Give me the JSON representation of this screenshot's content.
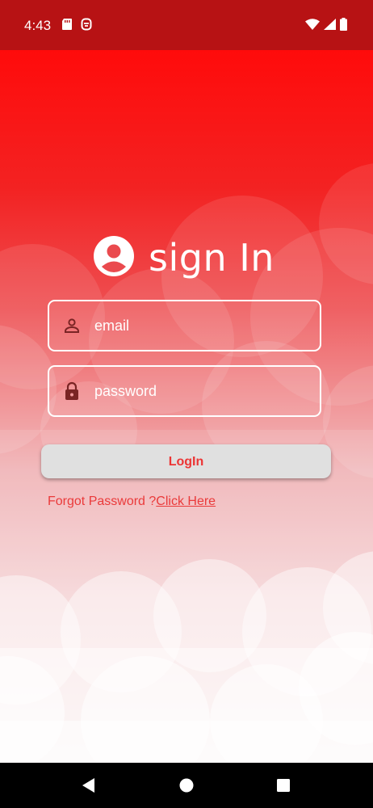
{
  "status_bar": {
    "time": "4:43",
    "left_icons": [
      "sd-card-icon",
      "notification-icon"
    ],
    "right_icons": [
      "wifi-icon",
      "cellular-signal-icon",
      "battery-icon"
    ]
  },
  "login": {
    "title": "sign In",
    "title_icon": "account-circle-icon",
    "email": {
      "placeholder": "email",
      "value": "",
      "icon": "person-icon"
    },
    "password": {
      "placeholder": "password",
      "value": "",
      "icon": "lock-icon"
    },
    "login_button": "LogIn",
    "forgot_text": "Forgot Password ?",
    "forgot_link": "Click Here"
  },
  "nav_bar": {
    "buttons": [
      "back-icon",
      "home-icon",
      "recents-icon"
    ]
  },
  "colors": {
    "status_bar": "#b71214",
    "accent": "#ec3535",
    "button_bg": "#e0e0e0",
    "field_border": "#ffffff"
  }
}
